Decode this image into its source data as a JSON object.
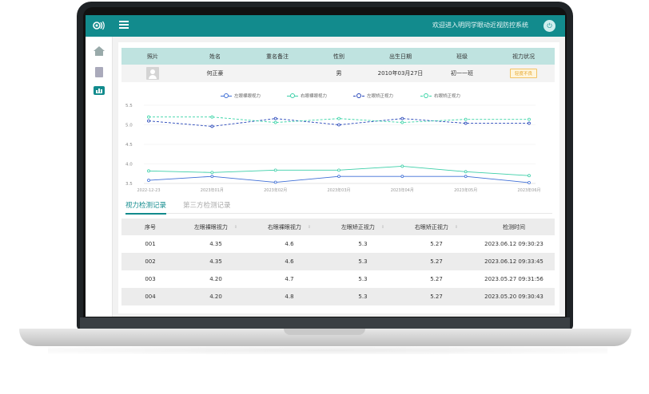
{
  "header": {
    "welcome_text": "欢迎进入明同学眼动近视防控系统",
    "logo_icon": "eye-logo-icon",
    "menu_icon": "menu-toggle-icon",
    "power_icon": "power-icon"
  },
  "sidebar": {
    "items": [
      {
        "name": "home",
        "icon": "home-icon"
      },
      {
        "name": "records",
        "icon": "document-icon"
      },
      {
        "name": "vision-stats",
        "icon": "bar-chart-icon",
        "active": true
      }
    ]
  },
  "student_info": {
    "headers": [
      "照片",
      "姓名",
      "重名备注",
      "性别",
      "出生日期",
      "班级",
      "视力状况"
    ],
    "row": {
      "photo": "avatar-placeholder",
      "name": "何正豪",
      "duplicate_note": "",
      "gender": "男",
      "birth_date": "2010年03月27日",
      "class": "初一一班",
      "vision_status": "轻度不良"
    }
  },
  "colors": {
    "accent": "#128b8d",
    "header_bg": "#bfe3e0",
    "left_naked": "#3f6fd6",
    "right_naked": "#3ccfa8",
    "left_corrected": "#2343b8",
    "right_corrected": "#38d4a6",
    "badge": "#e5a52c"
  },
  "chart_data": {
    "type": "line",
    "x": [
      "2022-12-23",
      "2023年01月",
      "2023年02月",
      "2023年03月",
      "2023年04月",
      "2023年05月",
      "2023年06月"
    ],
    "ylim": [
      3.5,
      5.5
    ],
    "y_ticks": [
      "5.5",
      "5.0",
      "4.5",
      "4.0",
      "3.5"
    ],
    "grid": true,
    "legend_position": "top",
    "series": [
      {
        "name": "左眼裸眼视力",
        "dashed": false,
        "values": [
          3.58,
          3.68,
          3.53,
          3.68,
          3.68,
          3.68,
          3.52
        ]
      },
      {
        "name": "右眼裸眼视力",
        "dashed": false,
        "values": [
          3.82,
          3.78,
          3.84,
          3.84,
          3.94,
          3.8,
          3.7
        ]
      },
      {
        "name": "左眼矫正视力",
        "dashed": true,
        "values": [
          5.1,
          4.96,
          5.16,
          5.0,
          5.16,
          5.04,
          5.04
        ]
      },
      {
        "name": "右眼矫正视力",
        "dashed": true,
        "values": [
          5.2,
          5.2,
          5.06,
          5.16,
          5.06,
          5.14,
          5.14
        ]
      }
    ]
  },
  "tabs": {
    "active": "视力检测记录",
    "other": "第三方检测记录"
  },
  "records": {
    "headers": [
      "序号",
      "左眼裸眼视力",
      "右眼裸眼视力",
      "左眼矫正视力",
      "右眼矫正视力",
      "检测时间"
    ],
    "rows": [
      [
        "001",
        "4.35",
        "4.6",
        "5.3",
        "5.27",
        "2023.06.12  09:30:23"
      ],
      [
        "002",
        "4.35",
        "4.6",
        "5.3",
        "5.27",
        "2023.06.12  09:33:45"
      ],
      [
        "003",
        "4.20",
        "4.7",
        "5.3",
        "5.27",
        "2023.05.27  09:31:56"
      ],
      [
        "004",
        "4.20",
        "4.8",
        "5.3",
        "5.27",
        "2023.05.20  09:30:43"
      ]
    ]
  }
}
